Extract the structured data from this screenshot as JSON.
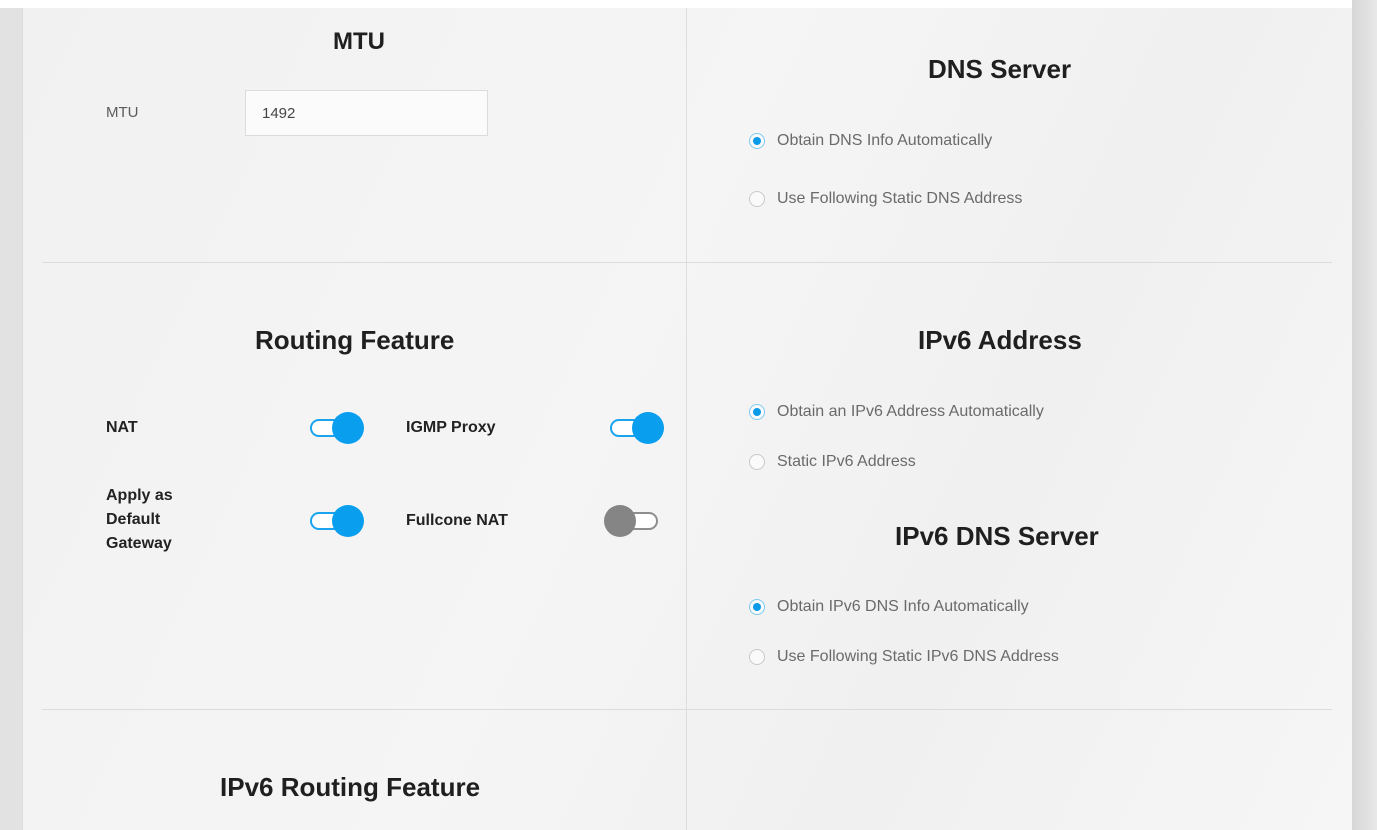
{
  "mtu": {
    "title": "MTU",
    "field_label": "MTU",
    "field_value": "1492"
  },
  "dns": {
    "title": "DNS Server",
    "options": [
      {
        "label": "Obtain DNS Info Automatically",
        "selected": true
      },
      {
        "label": "Use Following Static DNS Address",
        "selected": false
      }
    ]
  },
  "routing": {
    "title": "Routing Feature",
    "nat_label": "NAT",
    "nat_on": true,
    "igmp_label": "IGMP Proxy",
    "igmp_on": true,
    "default_gateway_label": "Apply as Default Gateway",
    "default_gateway_on": true,
    "fullcone_label": "Fullcone NAT",
    "fullcone_on": false
  },
  "ipv6_address": {
    "title": "IPv6 Address",
    "options": [
      {
        "label": "Obtain an IPv6 Address Automatically",
        "selected": true
      },
      {
        "label": "Static IPv6 Address",
        "selected": false
      }
    ]
  },
  "ipv6_dns": {
    "title": "IPv6 DNS Server",
    "options": [
      {
        "label": "Obtain IPv6 DNS Info Automatically",
        "selected": true
      },
      {
        "label": "Use Following Static IPv6 DNS Address",
        "selected": false
      }
    ]
  },
  "ipv6_routing": {
    "title": "IPv6 Routing Feature"
  },
  "colors": {
    "accent": "#0a9eef",
    "toggle_off": "#858585"
  }
}
